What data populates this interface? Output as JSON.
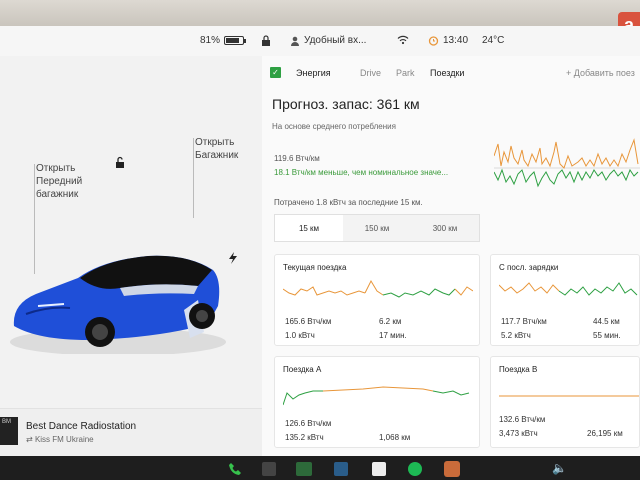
{
  "corner_badge": "a",
  "status": {
    "battery_pct": "81%",
    "battery_level": 0.81,
    "profile": "Удобный вх...",
    "time": "13:40",
    "temp": "24°C"
  },
  "left": {
    "rear_open_1": "Открыть",
    "rear_open_2": "Багажник",
    "front_open_1": "Открыть",
    "front_open_2": "Передний",
    "front_open_3": "багажник"
  },
  "media": {
    "art_text": "BM",
    "title": "Best Dance Radiostation",
    "station": "Kiss FM Ukraine"
  },
  "energy": {
    "tab_energy": "Энергия",
    "tab_drive": "Drive",
    "tab_park": "Park",
    "tab_trips": "Поездки",
    "add_label": "+ Добавить поез",
    "forecast": "Прогноз. запас: 361 км",
    "forecast_sub": "На основе среднего потребления",
    "consumption": "119.6 Втч/км",
    "consumption_note": "18.1 Втч/км меньше, чем номинальное значе...",
    "spent": "Потрачено 1.8 кВтч за последние 15 км.",
    "ranges": [
      "15 км",
      "150 км",
      "300 км"
    ]
  },
  "cards": {
    "current": {
      "title": "Текущая поездка",
      "wh": "165.6 Втч/км",
      "kwh": "1.0 кВтч",
      "km": "6.2 км",
      "min": "17 мин."
    },
    "since_charge": {
      "title": "С посл. зарядки",
      "wh": "117.7 Втч/км",
      "kwh": "5.2 кВтч",
      "km": "44.5 км",
      "min": "55 мин."
    },
    "trip_a": {
      "title": "Поездка А",
      "wh": "126.6 Втч/км",
      "kwh": "135.2 кВтч",
      "km": "1,068 км"
    },
    "trip_b": {
      "title": "Поездка В",
      "wh": "132.6 Втч/км",
      "kwh": "3,473 кВтч",
      "km": "26,195 км"
    }
  },
  "colors": {
    "accent_green": "#2ea043",
    "accent_orange": "#e8963a",
    "car_blue": "#1f4fd8"
  },
  "icons": [
    "battery-icon",
    "lock-icon",
    "profile-icon",
    "wifi-icon",
    "alarm-icon",
    "unlock-icon",
    "charge-icon",
    "play-icon",
    "heart-icon",
    "equalizer-icon",
    "search-icon",
    "phone-icon",
    "volume-icon"
  ]
}
